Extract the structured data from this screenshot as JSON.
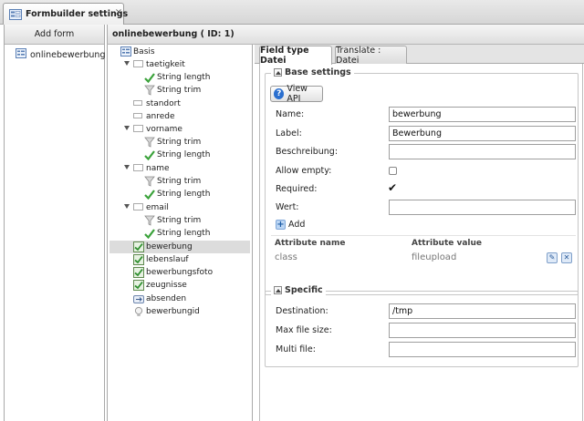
{
  "top_tab": {
    "title": "Formbuilder settings",
    "close_glyph": "×"
  },
  "left_panel": {
    "header": "Add form",
    "forms": [
      {
        "label": "onlinebewerbung",
        "icon": "form-icon"
      }
    ]
  },
  "main": {
    "header": "onlinebewerbung ( ID: 1)"
  },
  "tree": {
    "root": "Basis",
    "nodes": [
      {
        "label": "taetigkeit",
        "icon": "element-icon",
        "expandable": true
      },
      {
        "label": "String length",
        "icon": "validator-check-icon"
      },
      {
        "label": "String trim",
        "icon": "filter-funnel-icon"
      },
      {
        "label": "standort",
        "icon": "element-icon"
      },
      {
        "label": "anrede",
        "icon": "element-icon"
      },
      {
        "label": "vorname",
        "icon": "element-icon",
        "expandable": true
      },
      {
        "label": "String trim",
        "icon": "filter-funnel-icon"
      },
      {
        "label": "String length",
        "icon": "validator-check-icon"
      },
      {
        "label": "name",
        "icon": "element-icon",
        "expandable": true
      },
      {
        "label": "String trim",
        "icon": "filter-funnel-icon"
      },
      {
        "label": "String length",
        "icon": "validator-check-icon"
      },
      {
        "label": "email",
        "icon": "element-icon",
        "expandable": true
      },
      {
        "label": "String trim",
        "icon": "filter-funnel-icon"
      },
      {
        "label": "String length",
        "icon": "validator-check-icon"
      },
      {
        "label": "bewerbung",
        "icon": "file-upload-icon",
        "selected": true
      },
      {
        "label": "lebenslauf",
        "icon": "file-upload-icon"
      },
      {
        "label": "bewerbungsfoto",
        "icon": "file-upload-icon"
      },
      {
        "label": "zeugnisse",
        "icon": "file-upload-icon"
      },
      {
        "label": "absenden",
        "icon": "submit-icon"
      },
      {
        "label": "bewerbungid",
        "icon": "hidden-bulb-icon"
      }
    ]
  },
  "tabs": [
    {
      "label": "Field type Datei",
      "active": true
    },
    {
      "label": "Translate : Datei",
      "active": false
    }
  ],
  "base_settings": {
    "legend": "Base settings",
    "view_api_label": "View API",
    "fields": {
      "name": {
        "label": "Name:",
        "value": "bewerbung"
      },
      "label": {
        "label": "Label:",
        "value": "Bewerbung"
      },
      "beschreibung": {
        "label": "Beschreibung:",
        "value": ""
      },
      "allow_empty": {
        "label": "Allow empty:",
        "checked": false
      },
      "required": {
        "label": "Required:",
        "checked": true
      },
      "wert": {
        "label": "Wert:",
        "value": ""
      }
    },
    "add_label": "Add",
    "attributes": {
      "headers": [
        "Attribute name",
        "Attribute value"
      ],
      "rows": [
        {
          "name": "class",
          "value": "fileupload"
        }
      ]
    }
  },
  "specific": {
    "legend": "Specific",
    "fields": {
      "destination": {
        "label": "Destination:",
        "value": "/tmp"
      },
      "max_file_size": {
        "label": "Max file size:",
        "value": ""
      },
      "multi_file": {
        "label": "Multi file:",
        "value": ""
      }
    }
  }
}
